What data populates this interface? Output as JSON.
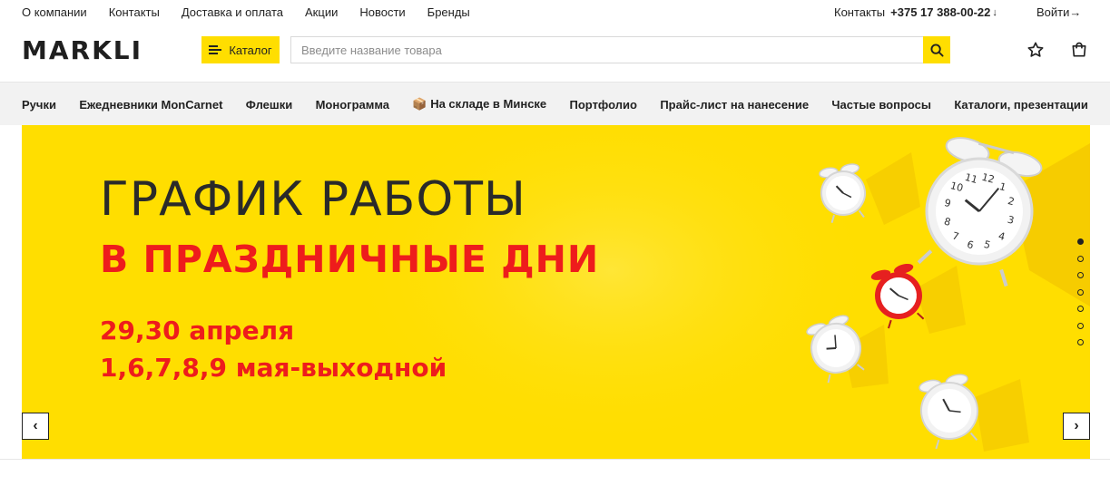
{
  "topnav": {
    "links": [
      "О компании",
      "Контакты",
      "Доставка и оплата",
      "Акции",
      "Новости",
      "Бренды"
    ]
  },
  "contacts": {
    "label": "Контакты",
    "phone": "+375 17 388-00-22",
    "arrow": "↓"
  },
  "login": {
    "label": "Войти→"
  },
  "header": {
    "logo": "MARKLI",
    "catalog_label": "Каталог",
    "search_placeholder": "Введите название товара",
    "icons": {
      "search": "search-icon",
      "favorites": "star-icon",
      "cart": "shopping-bag-icon",
      "menu": "menu-icon"
    }
  },
  "categories": [
    "Ручки",
    "Ежедневники MonCarnet",
    "Флешки",
    "Монограмма",
    "📦 На складе в Минске",
    "Портфолио",
    "Прайс-лист на нанесение",
    "Частые вопросы",
    "Каталоги, презентации"
  ],
  "banner": {
    "title": "ГРАФИК РАБОТЫ",
    "subtitle": "В ПРАЗДНИЧНЫЕ ДНИ",
    "line1": "29,30 апреля",
    "line2": "1,6,7,8,9 мая-выходной",
    "prev": "‹",
    "next": "›",
    "slide_count": 7,
    "active_slide": 1
  },
  "colors": {
    "accent": "#ffde00",
    "banner_red": "#ee1c1c",
    "text": "#222222",
    "nav_bg": "#f2f2f2"
  }
}
